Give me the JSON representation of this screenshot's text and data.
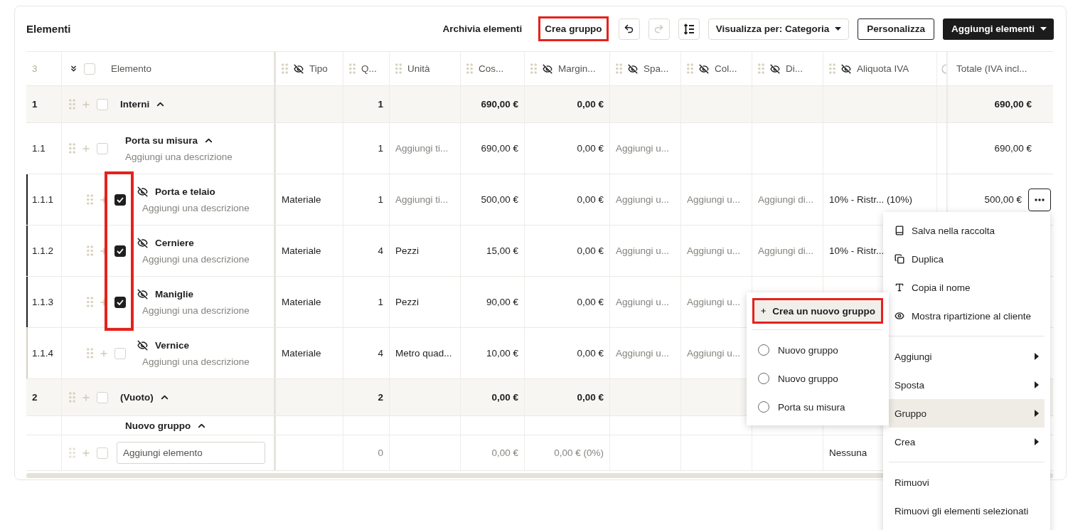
{
  "toolbar": {
    "title": "Elementi",
    "actions": [
      {
        "label": "Archivia elementi",
        "highlighted": false
      },
      {
        "label": "Crea gruppo",
        "highlighted": true
      }
    ],
    "undo": {
      "disabled": false
    },
    "redo": {
      "disabled": true
    },
    "view_select": {
      "label": "Visualizza per: Categoria"
    },
    "customize": "Personalizza",
    "add_button": "Aggiungi elementi"
  },
  "table": {
    "row_count": "3",
    "all_checked": false,
    "element_header": "Elemento",
    "columns": [
      {
        "label": "Tipo",
        "hidden": true,
        "kind": "text"
      },
      {
        "label": "Q...",
        "hidden": false,
        "kind": "number"
      },
      {
        "label": "Unità",
        "hidden": false,
        "kind": "text"
      },
      {
        "label": "Cos...",
        "hidden": false,
        "kind": "number"
      },
      {
        "label": "Margin...",
        "hidden": true,
        "kind": "number"
      },
      {
        "label": "Spa...",
        "hidden": true,
        "kind": "text"
      },
      {
        "label": "Col...",
        "hidden": true,
        "kind": "text"
      },
      {
        "label": "Di...",
        "hidden": true,
        "kind": "text"
      },
      {
        "label": "Aliquota IVA",
        "hidden": true,
        "kind": "text"
      },
      {
        "kind": "clipped"
      },
      {
        "label": "Totale (IVA incl...",
        "hidden": false,
        "kind": "total"
      }
    ],
    "rows": [
      {
        "kind": "group",
        "number": "1",
        "name": "Interni",
        "expanded": true,
        "checked": false,
        "cells": [
          null,
          "1",
          null,
          "690,00 €",
          "0,00 €",
          null,
          null,
          null,
          null,
          null,
          "690,00 €"
        ]
      },
      {
        "kind": "subgroup",
        "number": "1.1",
        "name": "Porta su misura",
        "description_placeholder": "Aggiungi una descrizione",
        "expanded": true,
        "checked": false,
        "cells": [
          null,
          "1",
          {
            "placeholder": "Aggiungi ti..."
          },
          "690,00 €",
          "0,00 €",
          {
            "placeholder": "Aggiungi u..."
          },
          null,
          null,
          null,
          null,
          "690,00 €"
        ]
      },
      {
        "kind": "item",
        "number": "1.1.1",
        "name": "Porta e telaio",
        "description_placeholder": "Aggiungi una descrizione",
        "hidden": true,
        "checked": true,
        "highlighted": true,
        "menu_button": true,
        "cells": [
          "Materiale",
          "1",
          {
            "placeholder": "Aggiungi ti..."
          },
          "500,00 €",
          "0,00 €",
          {
            "placeholder": "Aggiungi u..."
          },
          {
            "placeholder": "Aggiungi u..."
          },
          {
            "placeholder": "Aggiungi di..."
          },
          "10% - Ristr...  (10%)",
          null,
          "500,00 €"
        ]
      },
      {
        "kind": "item",
        "number": "1.1.2",
        "name": "Cerniere",
        "description_placeholder": "Aggiungi una descrizione",
        "hidden": true,
        "checked": true,
        "highlighted": true,
        "menu_button": false,
        "cells": [
          "Materiale",
          "4",
          "Pezzi",
          "15,00 €",
          "0,00 €",
          {
            "placeholder": "Aggiungi u..."
          },
          {
            "placeholder": "Aggiungi u..."
          },
          {
            "placeholder": "Aggiungi di..."
          },
          "10% - Ristr...",
          null,
          null
        ]
      },
      {
        "kind": "item",
        "number": "1.1.3",
        "name": "Maniglie",
        "description_placeholder": "Aggiungi una descrizione",
        "hidden": true,
        "checked": true,
        "highlighted": true,
        "menu_button": false,
        "cells": [
          "Materiale",
          "1",
          "Pezzi",
          "90,00 €",
          "0,00 €",
          {
            "placeholder": "Aggiungi u..."
          },
          {
            "placeholder": "Aggiungi u..."
          },
          null,
          null,
          null,
          null
        ]
      },
      {
        "kind": "item",
        "number": "1.1.4",
        "name": "Vernice",
        "description_placeholder": "Aggiungi una descrizione",
        "hidden": true,
        "checked": false,
        "highlighted": false,
        "menu_button": false,
        "cells": [
          "Materiale",
          "4",
          "Metro quad...",
          "10,00 €",
          "0,00 €",
          {
            "placeholder": "Aggiungi u..."
          },
          {
            "placeholder": "Aggiungi u..."
          },
          null,
          null,
          null,
          null
        ]
      },
      {
        "kind": "group",
        "number": "2",
        "name": "(Vuoto)",
        "expanded": true,
        "checked": false,
        "cells": [
          null,
          "2",
          null,
          "0,00 €",
          "0,00 €",
          null,
          null,
          null,
          null,
          null,
          null
        ]
      },
      {
        "kind": "heading",
        "name": "Nuovo gruppo",
        "expanded": true,
        "cells": [
          null,
          null,
          null,
          null,
          null,
          null,
          null,
          null,
          null,
          null,
          null
        ]
      },
      {
        "kind": "add",
        "checked": false,
        "input_placeholder": "Aggiungi elemento",
        "cells": [
          null,
          {
            "placeholder": "0"
          },
          null,
          {
            "placeholder": "0,00 €"
          },
          {
            "placeholder": "0,00 € (0%)"
          },
          null,
          null,
          null,
          "Nessuna",
          null,
          null
        ]
      }
    ]
  },
  "context_menu": {
    "sections": [
      [
        {
          "label": "Salva nella raccolta",
          "kind": "action",
          "selected": false
        },
        {
          "label": "Duplica",
          "kind": "action",
          "selected": false
        },
        {
          "label": "Copia il nome",
          "kind": "action",
          "selected": false
        },
        {
          "label": "Mostra ripartizione al cliente",
          "kind": "action",
          "selected": false
        }
      ],
      [
        {
          "label": "Aggiungi",
          "kind": "submenu",
          "selected": false
        },
        {
          "label": "Sposta",
          "kind": "submenu",
          "selected": false
        },
        {
          "label": "Gruppo",
          "kind": "submenu",
          "selected": true
        },
        {
          "label": "Crea",
          "kind": "submenu",
          "selected": false
        }
      ],
      [
        {
          "label": "Rimuovi",
          "kind": "plain",
          "selected": false
        },
        {
          "label": "Rimuovi gli elementi selezionati",
          "kind": "plain",
          "selected": false
        }
      ]
    ]
  },
  "group_submenu": {
    "create": {
      "label": "Crea un nuovo gruppo",
      "highlighted": true
    },
    "options": [
      {
        "label": "Nuovo gruppo",
        "selected": false
      },
      {
        "label": "Nuovo gruppo",
        "selected": false
      },
      {
        "label": "Porta su misura",
        "selected": false
      }
    ]
  }
}
